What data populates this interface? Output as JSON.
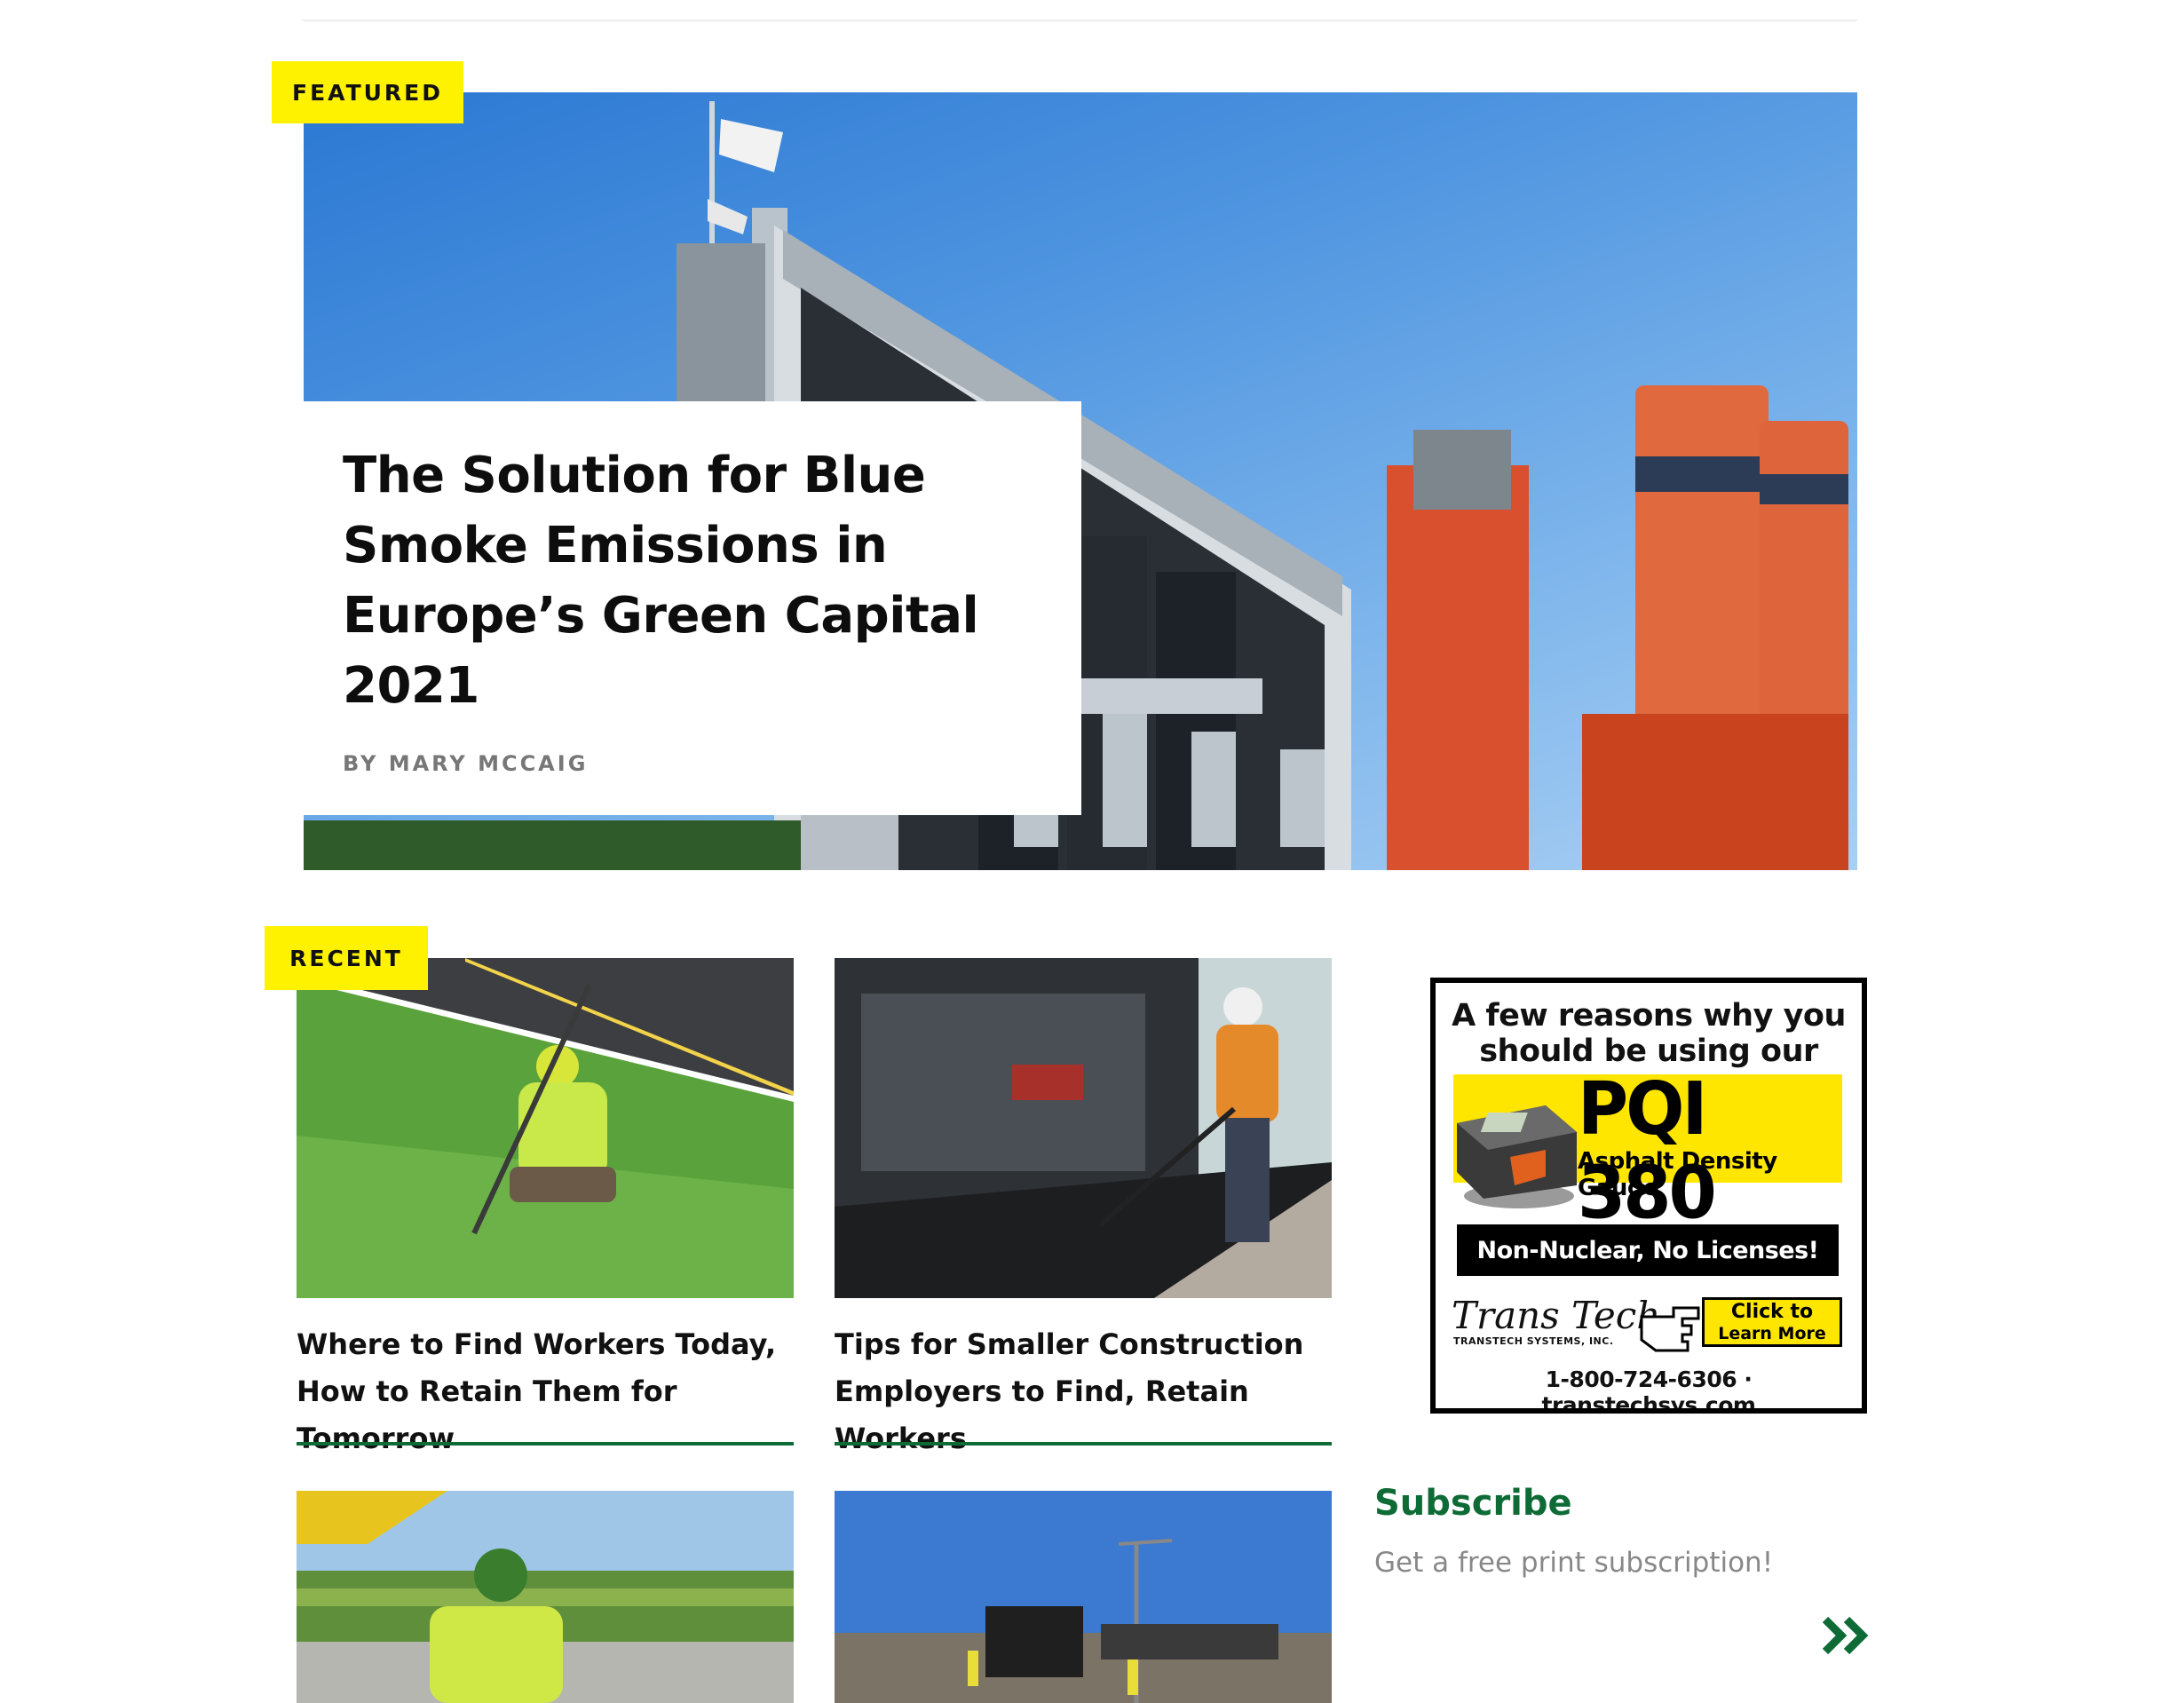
{
  "featured": {
    "tag": "FEATURED",
    "title": "The Solution for Blue Smoke Emissions in Europe’s Green Capital 2021",
    "byline": "BY MARY MCCAIG"
  },
  "recent": {
    "tag": "RECENT",
    "articles": [
      {
        "title": "Where to Find Workers Today, How to Retain Them for Tomorrow"
      },
      {
        "title": "Tips for Smaller Construction Employers to Find, Retain Workers"
      },
      {
        "title": ""
      },
      {
        "title": ""
      }
    ]
  },
  "ad": {
    "headline_line1": "A few reasons why you",
    "headline_line2": "should be using our",
    "product": "PQI 380",
    "product_sub": "Asphalt Density Gauge",
    "banner": "Non-Nuclear, No Licenses!",
    "brand": "Trans Tech",
    "brand_sub": "TRANSTECH SYSTEMS, INC.",
    "cta_line1": "Click to",
    "cta_line2": "Learn More",
    "contact": "1-800-724-6306 · transtechsys.com"
  },
  "subscribe": {
    "title": "Subscribe",
    "text": "Get a free print subscription!",
    "arrow_icon": "double-chevron-right-icon"
  },
  "colors": {
    "accent_green": "#0e6b36",
    "tag_yellow": "#fff200"
  }
}
